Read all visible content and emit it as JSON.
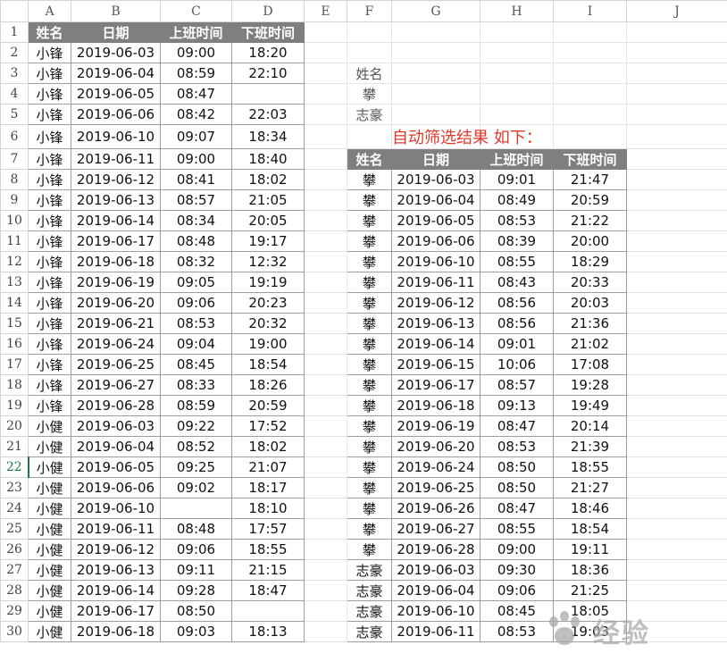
{
  "columns": [
    "A",
    "B",
    "C",
    "D",
    "E",
    "F",
    "G",
    "H",
    "I",
    "J"
  ],
  "active_row": "22",
  "headers": [
    "姓名",
    "日期",
    "上班时间",
    "下班时间"
  ],
  "criteria": {
    "label": "姓名",
    "values": [
      "攀",
      "志豪"
    ]
  },
  "note": "自动筛选结果  如下：",
  "source": [
    [
      "小锋",
      "2019-06-03",
      "09:00",
      "18:20"
    ],
    [
      "小锋",
      "2019-06-04",
      "08:59",
      "22:10"
    ],
    [
      "小锋",
      "2019-06-05",
      "08:47",
      ""
    ],
    [
      "小锋",
      "2019-06-06",
      "08:42",
      "22:03"
    ],
    [
      "小锋",
      "2019-06-10",
      "09:07",
      "18:34"
    ],
    [
      "小锋",
      "2019-06-11",
      "09:00",
      "18:40"
    ],
    [
      "小锋",
      "2019-06-12",
      "08:41",
      "18:02"
    ],
    [
      "小锋",
      "2019-06-13",
      "08:57",
      "21:05"
    ],
    [
      "小锋",
      "2019-06-14",
      "08:34",
      "20:05"
    ],
    [
      "小锋",
      "2019-06-17",
      "08:48",
      "19:17"
    ],
    [
      "小锋",
      "2019-06-18",
      "08:32",
      "12:32"
    ],
    [
      "小锋",
      "2019-06-19",
      "09:05",
      "19:19"
    ],
    [
      "小锋",
      "2019-06-20",
      "09:06",
      "20:23"
    ],
    [
      "小锋",
      "2019-06-21",
      "08:53",
      "20:32"
    ],
    [
      "小锋",
      "2019-06-24",
      "09:04",
      "19:00"
    ],
    [
      "小锋",
      "2019-06-25",
      "08:45",
      "18:54"
    ],
    [
      "小锋",
      "2019-06-27",
      "08:33",
      "18:26"
    ],
    [
      "小锋",
      "2019-06-28",
      "08:59",
      "20:59"
    ],
    [
      "小健",
      "2019-06-03",
      "09:22",
      "17:52"
    ],
    [
      "小健",
      "2019-06-04",
      "08:52",
      "18:02"
    ],
    [
      "小健",
      "2019-06-05",
      "09:25",
      "21:07"
    ],
    [
      "小健",
      "2019-06-06",
      "09:02",
      "18:17"
    ],
    [
      "小健",
      "2019-06-10",
      "",
      "18:10"
    ],
    [
      "小健",
      "2019-06-11",
      "08:48",
      "17:57"
    ],
    [
      "小健",
      "2019-06-12",
      "09:06",
      "18:55"
    ],
    [
      "小健",
      "2019-06-13",
      "09:11",
      "21:15"
    ],
    [
      "小健",
      "2019-06-14",
      "09:28",
      "18:47"
    ],
    [
      "小健",
      "2019-06-17",
      "08:50",
      ""
    ],
    [
      "小健",
      "2019-06-18",
      "09:03",
      "18:13"
    ]
  ],
  "result": [
    [
      "攀",
      "2019-06-03",
      "09:01",
      "21:47"
    ],
    [
      "攀",
      "2019-06-04",
      "08:49",
      "20:59"
    ],
    [
      "攀",
      "2019-06-05",
      "08:53",
      "21:22"
    ],
    [
      "攀",
      "2019-06-06",
      "08:39",
      "20:00"
    ],
    [
      "攀",
      "2019-06-10",
      "08:55",
      "18:29"
    ],
    [
      "攀",
      "2019-06-11",
      "08:43",
      "20:33"
    ],
    [
      "攀",
      "2019-06-12",
      "08:56",
      "20:03"
    ],
    [
      "攀",
      "2019-06-13",
      "08:56",
      "21:36"
    ],
    [
      "攀",
      "2019-06-14",
      "09:01",
      "21:02"
    ],
    [
      "攀",
      "2019-06-15",
      "10:06",
      "17:08"
    ],
    [
      "攀",
      "2019-06-17",
      "08:57",
      "19:28"
    ],
    [
      "攀",
      "2019-06-18",
      "09:13",
      "19:49"
    ],
    [
      "攀",
      "2019-06-19",
      "08:47",
      "20:14"
    ],
    [
      "攀",
      "2019-06-20",
      "08:53",
      "21:39"
    ],
    [
      "攀",
      "2019-06-24",
      "08:50",
      "18:55"
    ],
    [
      "攀",
      "2019-06-25",
      "08:50",
      "21:27"
    ],
    [
      "攀",
      "2019-06-26",
      "08:47",
      "18:46"
    ],
    [
      "攀",
      "2019-06-27",
      "08:55",
      "18:54"
    ],
    [
      "攀",
      "2019-06-28",
      "09:00",
      "19:11"
    ],
    [
      "志豪",
      "2019-06-03",
      "09:30",
      "18:36"
    ],
    [
      "志豪",
      "2019-06-04",
      "09:06",
      "21:25"
    ],
    [
      "志豪",
      "2019-06-10",
      "08:45",
      "18:05"
    ],
    [
      "志豪",
      "2019-06-11",
      "08:53",
      "19:03"
    ]
  ],
  "watermark": "经验"
}
